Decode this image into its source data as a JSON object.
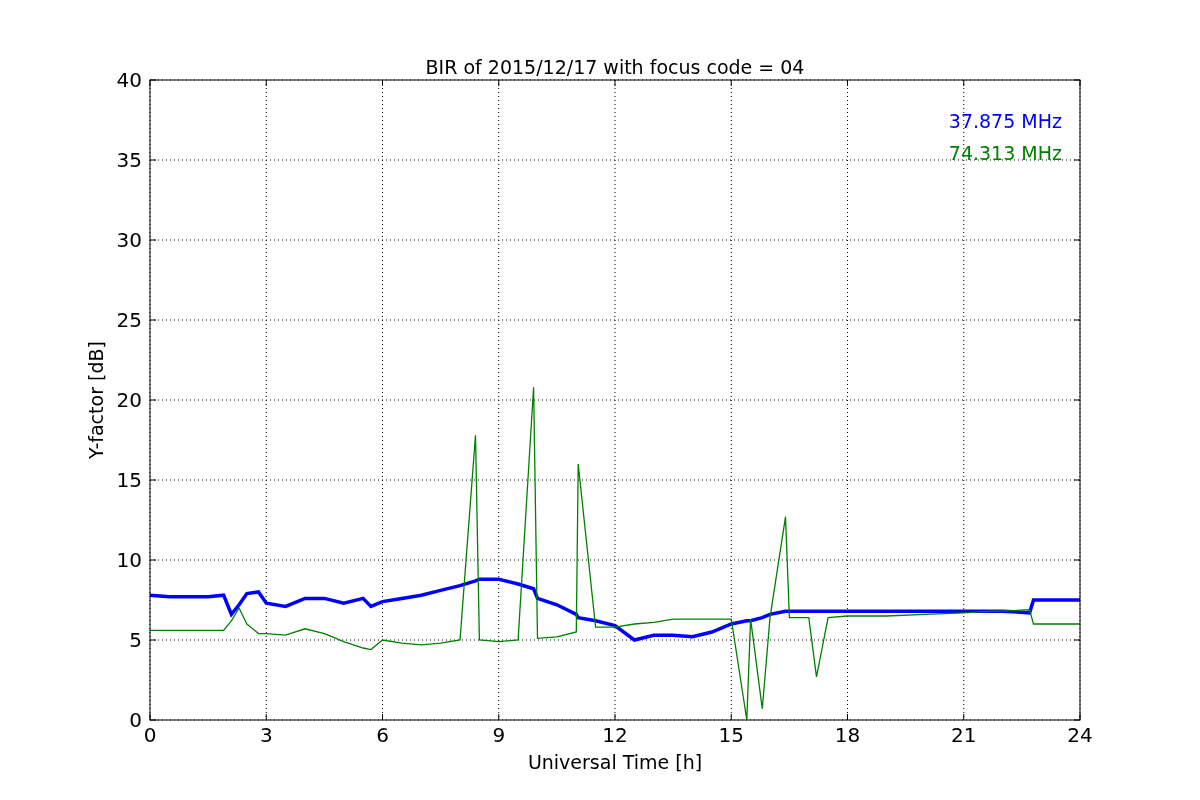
{
  "figure": {
    "chart_data": {
      "type": "line",
      "title": "BIR of 2015/12/17 with focus code = 04",
      "xlabel": "Universal Time [h]",
      "ylabel": "Y-factor [dB]",
      "x": [
        0,
        0.5,
        1,
        1.5,
        1.9,
        2.1,
        2.3,
        2.5,
        2.8,
        3,
        3.5,
        4,
        4.5,
        5,
        5.5,
        5.7,
        6,
        6.5,
        7,
        7.5,
        8,
        8.4,
        8.5,
        9,
        9.5,
        9.9,
        10,
        10.5,
        11,
        11.05,
        11.5,
        12,
        12.5,
        13,
        13.5,
        14,
        14.5,
        15,
        15.4,
        15.5,
        15.8,
        16,
        16.4,
        16.5,
        17,
        17.2,
        17.5,
        18,
        19,
        20,
        21,
        21.7,
        22,
        22.7,
        22.8,
        23,
        23.5,
        24
      ],
      "series": [
        {
          "name": "37.875 MHz",
          "color": "#0000ff",
          "values": [
            7.8,
            7.7,
            7.7,
            7.7,
            7.8,
            6.6,
            7.2,
            7.9,
            8.0,
            7.3,
            7.1,
            7.6,
            7.6,
            7.3,
            7.6,
            7.1,
            7.4,
            7.6,
            7.8,
            8.1,
            8.4,
            8.7,
            8.8,
            8.8,
            8.5,
            8.2,
            7.6,
            7.2,
            6.6,
            6.4,
            6.2,
            5.9,
            5.0,
            5.3,
            5.3,
            5.2,
            5.5,
            6.0,
            6.2,
            6.2,
            6.4,
            6.6,
            6.8,
            6.8,
            6.8,
            6.8,
            6.8,
            6.8,
            6.8,
            6.8,
            6.8,
            6.8,
            6.8,
            6.7,
            7.5,
            7.5,
            7.5,
            7.5
          ]
        },
        {
          "name": "74.313 MHz",
          "color": "#008000",
          "values": [
            5.6,
            5.6,
            5.6,
            5.6,
            5.6,
            6.2,
            7.0,
            6.0,
            5.4,
            5.4,
            5.3,
            5.7,
            5.4,
            4.9,
            4.5,
            4.4,
            5.0,
            4.8,
            4.7,
            4.8,
            5.0,
            17.8,
            5.0,
            4.9,
            5.0,
            20.8,
            5.1,
            5.2,
            5.5,
            16.0,
            5.8,
            5.8,
            6.0,
            6.1,
            6.3,
            6.3,
            6.3,
            6.3,
            0.0,
            6.3,
            0.7,
            6.4,
            12.7,
            6.4,
            6.4,
            2.7,
            6.4,
            6.5,
            6.5,
            6.6,
            6.7,
            6.8,
            6.8,
            6.9,
            6.0,
            6.0,
            6.0,
            6.0
          ]
        }
      ],
      "grid": true,
      "xlim": [
        0,
        24
      ],
      "ylim": [
        0,
        40
      ],
      "xticks": [
        0,
        3,
        6,
        9,
        12,
        15,
        18,
        21,
        24
      ],
      "yticks": [
        0,
        5,
        10,
        15,
        20,
        25,
        30,
        35,
        40
      ]
    }
  }
}
